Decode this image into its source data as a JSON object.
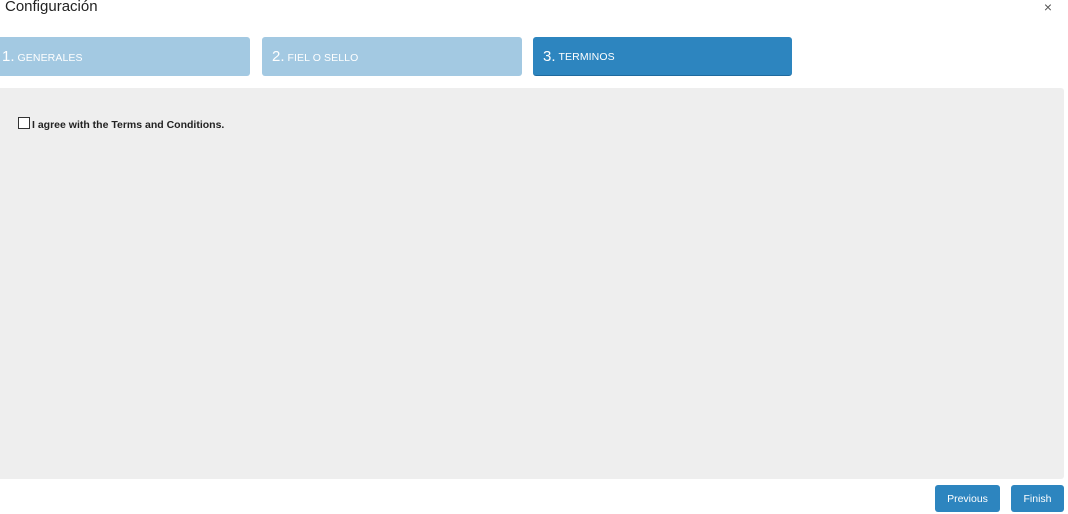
{
  "dialog": {
    "title": "Configuración",
    "close_glyph": "×"
  },
  "steps": [
    {
      "number": "1.",
      "label": "GENERALES",
      "state": "completed"
    },
    {
      "number": "2.",
      "label": "FIEL o SELLO",
      "state": "completed"
    },
    {
      "number": "3.",
      "label": "TERMINOS",
      "state": "active"
    }
  ],
  "terms": {
    "checkbox_label": "I agree with the Terms and Conditions.",
    "checked": false
  },
  "footer": {
    "previous_label": "Previous",
    "finish_label": "Finish"
  },
  "colors": {
    "active_step": "#2d85bf",
    "inactive_step": "#a3c9e2",
    "content_bg": "#eeeeee",
    "button": "#2d85bf"
  },
  "icons": {
    "close": "close-icon"
  }
}
